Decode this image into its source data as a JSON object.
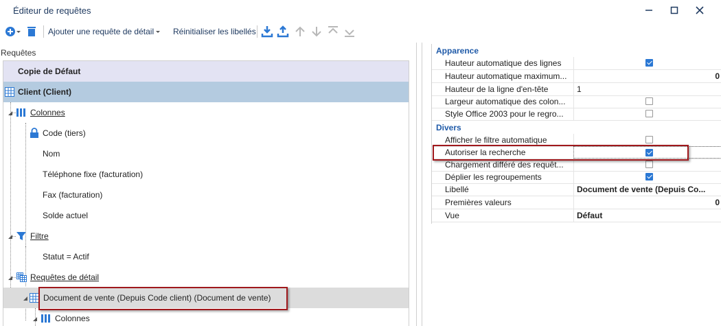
{
  "window": {
    "title": "Éditeur de requêtes",
    "minimize": "—",
    "maximize": "☐",
    "close": "✕"
  },
  "toolbar": {
    "add_detail_label": "Ajouter une requête de détail",
    "reset_labels_label": "Réinitialiser les libellés"
  },
  "left": {
    "section_label": "Requêtes",
    "tree": {
      "copie": "Copie de Défaut",
      "client": "Client (Client)",
      "colonnes": "Colonnes",
      "code": "Code (tiers)",
      "nom": "Nom",
      "tel": "Téléphone fixe (facturation)",
      "fax": "Fax (facturation)",
      "solde": "Solde actuel",
      "filtre": "Filtre",
      "statut": "Statut = Actif",
      "requetes_detail": "Requêtes de détail",
      "document": "Document de vente (Depuis Code client) (Document de vente)",
      "colonnes2": "Colonnes"
    }
  },
  "properties": {
    "apparence": {
      "title": "Apparence",
      "rows": [
        {
          "name": "Hauteur automatique des lignes",
          "checked": true
        },
        {
          "name": "Hauteur automatique maximum...",
          "value": "0"
        },
        {
          "name": "Hauteur de la ligne d'en-tête",
          "value": "1"
        },
        {
          "name": "Largeur automatique des colon...",
          "checked": false
        },
        {
          "name": "Style Office 2003 pour le regro...",
          "checked": false
        }
      ]
    },
    "divers": {
      "title": "Divers",
      "rows": [
        {
          "name": "Afficher le filtre automatique",
          "checked": false
        },
        {
          "name": "Autoriser la recherche",
          "checked": true
        },
        {
          "name": "Chargement différé des requêt...",
          "checked": false
        },
        {
          "name": "Déplier les regroupements",
          "checked": true
        },
        {
          "name": "Libellé",
          "value": "Document de vente (Depuis Co..."
        },
        {
          "name": "Premières valeurs",
          "value": "0"
        },
        {
          "name": "Vue",
          "value": "Défaut"
        }
      ]
    }
  },
  "colors": {
    "accent": "#2b78d4",
    "highlight": "#a0181c",
    "selection": "#b4cbe0"
  }
}
